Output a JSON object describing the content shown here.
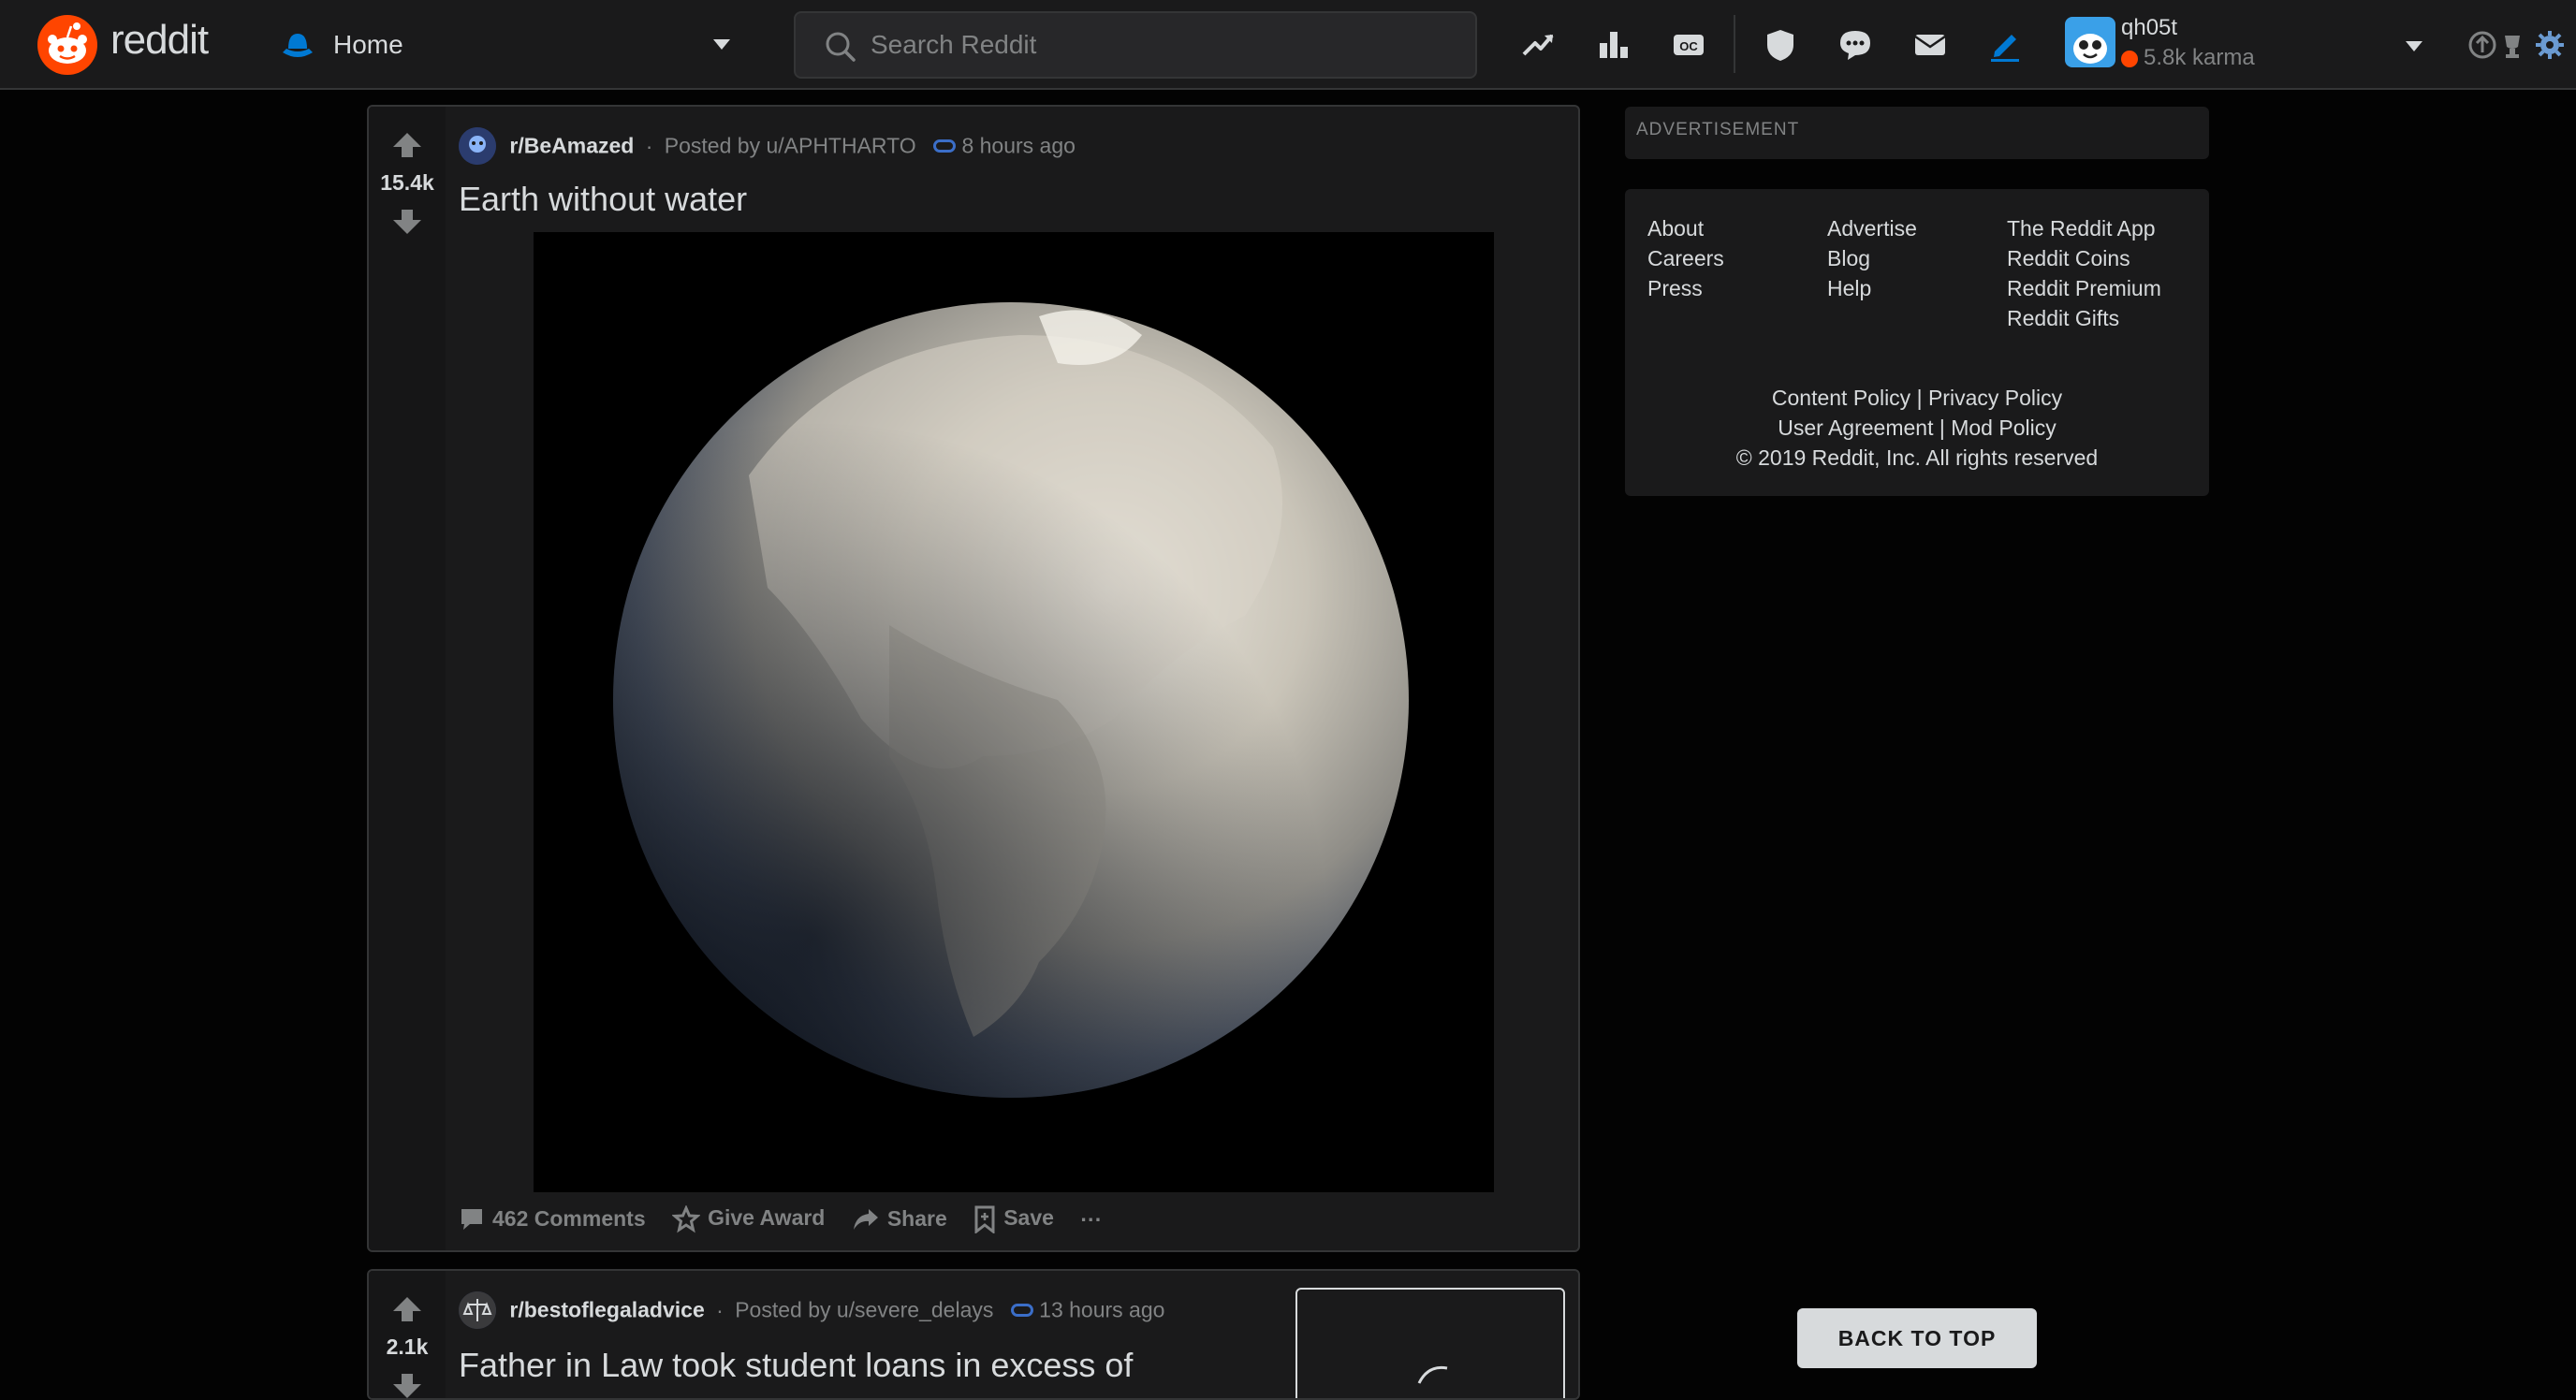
{
  "header": {
    "wordmark": "reddit",
    "feed_label": "Home",
    "search_placeholder": "Search Reddit",
    "icons": [
      "trending-icon",
      "stats-icon",
      "oc-icon",
      "shield-icon",
      "chat-icon",
      "mail-icon",
      "pencil-icon"
    ],
    "oc_text": "OC",
    "user": {
      "name": "qh05t",
      "karma": "5.8k karma"
    }
  },
  "posts": [
    {
      "score": "15.4k",
      "subreddit": "r/BeAmazed",
      "separator": "·",
      "posted_by": "Posted by u/APHTHARTO",
      "time": "8 hours ago",
      "title": "Earth without water",
      "actions": {
        "comments": "462 Comments",
        "award": "Give Award",
        "share": "Share",
        "save": "Save",
        "more": "···"
      }
    },
    {
      "score": "2.1k",
      "subreddit": "r/bestoflegaladvice",
      "separator": "·",
      "posted_by": "Posted by u/severe_delays",
      "time": "13 hours ago",
      "title": "Father in Law took student loans in excess of"
    }
  ],
  "sidebar": {
    "ad_label": "ADVERTISEMENT",
    "footer_col1": [
      "About",
      "Careers",
      "Press"
    ],
    "footer_col2": [
      "Advertise",
      "Blog",
      "Help"
    ],
    "footer_col3": [
      "The Reddit App",
      "Reddit Coins",
      "Reddit Premium",
      "Reddit Gifts"
    ],
    "policy_row1": [
      "Content Policy",
      "Privacy Policy"
    ],
    "policy_row2": [
      "User Agreement",
      "Mod Policy"
    ],
    "policy_sep": "|",
    "copyright": "© 2019 Reddit, Inc. All rights reserved"
  },
  "back_to_top": "BACK TO TOP",
  "colors": {
    "accent": "#ff4500",
    "link_blue": "#0079d3",
    "background": "#030303",
    "card": "#1a1a1b"
  }
}
